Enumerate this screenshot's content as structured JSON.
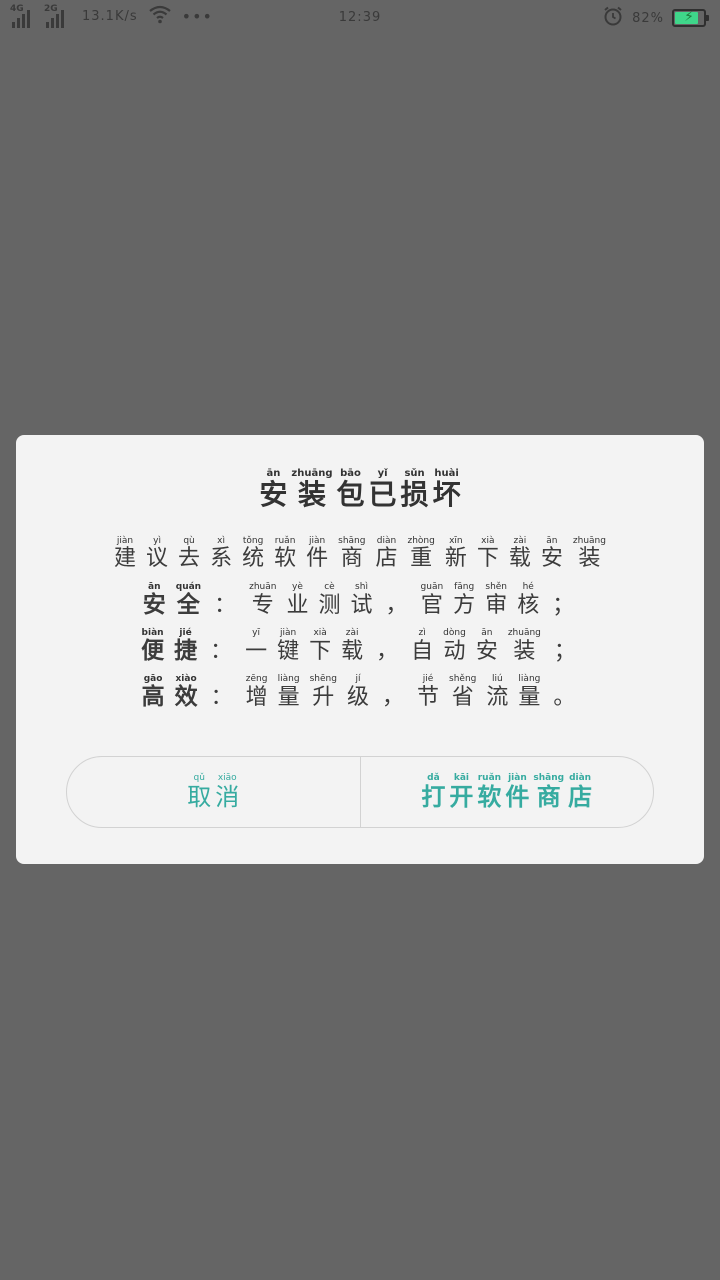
{
  "status_bar": {
    "net1": "4G",
    "net2": "2G",
    "speed": "13.1K/s",
    "more": "•••",
    "time": "12:39",
    "battery_percent": "82%",
    "battery_level": 0.82,
    "battery_color": "#3fd68a",
    "icons": [
      "signal-icon",
      "wifi-icon",
      "alarm-icon",
      "battery-charging-icon"
    ]
  },
  "dialog": {
    "title": [
      {
        "c": "安",
        "p": "ān"
      },
      {
        "c": "装",
        "p": "zhuāng"
      },
      {
        "c": "包",
        "p": "bāo"
      },
      {
        "c": "已",
        "p": "yǐ"
      },
      {
        "c": "损",
        "p": "sǔn"
      },
      {
        "c": "坏",
        "p": "huài"
      }
    ],
    "lines": [
      [
        {
          "c": "建",
          "p": "jiàn"
        },
        {
          "c": "议",
          "p": "yì"
        },
        {
          "c": "去",
          "p": "qù"
        },
        {
          "c": "系",
          "p": "xì"
        },
        {
          "c": "统",
          "p": "tǒng"
        },
        {
          "c": "软",
          "p": "ruǎn"
        },
        {
          "c": "件",
          "p": "jiàn"
        },
        {
          "c": "商",
          "p": "shāng"
        },
        {
          "c": "店",
          "p": "diàn"
        },
        {
          "c": "重",
          "p": "zhòng"
        },
        {
          "c": "新",
          "p": "xīn"
        },
        {
          "c": "下",
          "p": "xià"
        },
        {
          "c": "载",
          "p": "zài"
        },
        {
          "c": "安",
          "p": "ān"
        },
        {
          "c": "装",
          "p": "zhuāng"
        }
      ],
      [
        {
          "c": "安",
          "p": "ān",
          "b": true
        },
        {
          "c": "全",
          "p": "quán",
          "b": true
        },
        {
          "c": "：",
          "p": ""
        },
        {
          "c": "专",
          "p": "zhuān"
        },
        {
          "c": "业",
          "p": "yè"
        },
        {
          "c": "测",
          "p": "cè"
        },
        {
          "c": "试",
          "p": "shì"
        },
        {
          "c": "，",
          "p": ""
        },
        {
          "c": "官",
          "p": "guān"
        },
        {
          "c": "方",
          "p": "fāng"
        },
        {
          "c": "审",
          "p": "shěn"
        },
        {
          "c": "核",
          "p": "hé"
        },
        {
          "c": "；",
          "p": ""
        }
      ],
      [
        {
          "c": "便",
          "p": "biàn",
          "b": true
        },
        {
          "c": "捷",
          "p": "jié",
          "b": true
        },
        {
          "c": "：",
          "p": ""
        },
        {
          "c": "一",
          "p": "yī"
        },
        {
          "c": "键",
          "p": "jiàn"
        },
        {
          "c": "下",
          "p": "xià"
        },
        {
          "c": "载",
          "p": "zài"
        },
        {
          "c": "，",
          "p": ""
        },
        {
          "c": "自",
          "p": "zì"
        },
        {
          "c": "动",
          "p": "dòng"
        },
        {
          "c": "安",
          "p": "ān"
        },
        {
          "c": "装",
          "p": "zhuāng"
        },
        {
          "c": "；",
          "p": ""
        }
      ],
      [
        {
          "c": "高",
          "p": "gāo",
          "b": true
        },
        {
          "c": "效",
          "p": "xiào",
          "b": true
        },
        {
          "c": "：",
          "p": ""
        },
        {
          "c": "增",
          "p": "zēng"
        },
        {
          "c": "量",
          "p": "liàng"
        },
        {
          "c": "升",
          "p": "shēng"
        },
        {
          "c": "级",
          "p": "jí"
        },
        {
          "c": "，",
          "p": ""
        },
        {
          "c": "节",
          "p": "jié"
        },
        {
          "c": "省",
          "p": "shěng"
        },
        {
          "c": "流",
          "p": "liú"
        },
        {
          "c": "量",
          "p": "liàng"
        },
        {
          "c": "。",
          "p": ""
        }
      ]
    ],
    "cancel": [
      {
        "c": "取",
        "p": "qǔ"
      },
      {
        "c": "消",
        "p": "xiāo"
      }
    ],
    "open_store": [
      {
        "c": "打",
        "p": "dǎ"
      },
      {
        "c": "开",
        "p": "kāi"
      },
      {
        "c": "软",
        "p": "ruǎn"
      },
      {
        "c": "件",
        "p": "jiàn"
      },
      {
        "c": "商",
        "p": "shāng"
      },
      {
        "c": "店",
        "p": "diàn"
      }
    ],
    "accent_color": "#36aba0"
  }
}
